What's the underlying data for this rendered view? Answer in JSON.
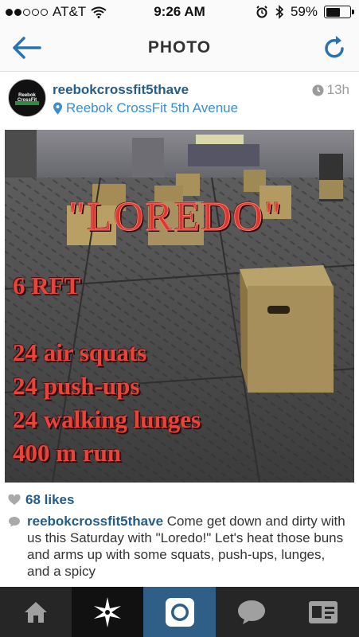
{
  "status_bar": {
    "carrier": "AT&T",
    "time": "9:26 AM",
    "battery_percent_label": "59%",
    "battery_level": 0.59,
    "signal_bars_filled": 2,
    "signal_bars_total": 5
  },
  "nav": {
    "title": "PHOTO",
    "back_icon": "back-arrow-icon",
    "refresh_icon": "refresh-icon"
  },
  "post": {
    "username": "reebokcrossfit5thave",
    "location": "Reebok CrossFit 5th Avenue",
    "time_ago": "13h",
    "avatar_text": "Reebok CrossFit",
    "photo_overlay": {
      "title": "\"LOREDO\"",
      "rounds": "6 RFT",
      "lines": [
        "24 air squats",
        "24 push-ups",
        "24 walking lunges",
        "400 m run"
      ]
    },
    "likes": "68 likes",
    "caption_user": "reebokcrossfit5thave",
    "caption_text": " Come get down and dirty with us this Saturday with \"Loredo!\" Let's heat those buns and arms up with some squats, push-ups, lunges, and a spicy"
  },
  "tab_bar": {
    "tabs": [
      "home-icon",
      "explore-star-icon",
      "camera-icon",
      "news-bubble-icon",
      "profile-card-icon"
    ],
    "active_tab": "explore-star-icon"
  },
  "colors": {
    "accent": "#3b8ed0",
    "username": "#245d8a",
    "overlay_red": "#e8443a",
    "tab_bar": "#262626",
    "camera_tab": "#2f5f86"
  }
}
